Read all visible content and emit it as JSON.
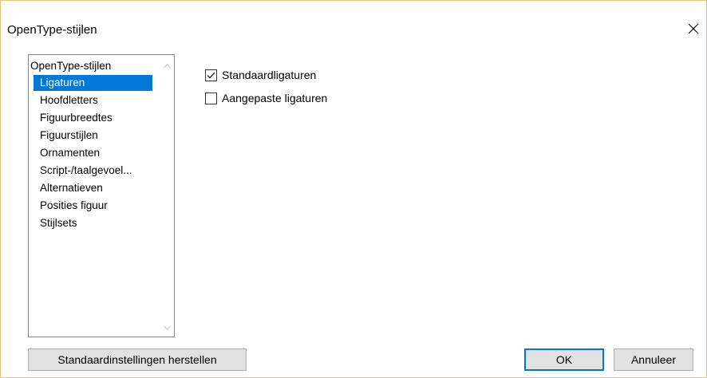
{
  "window": {
    "title": "OpenType-stijlen"
  },
  "features_list": {
    "root": "OpenType-stijlen",
    "items": [
      "Ligaturen",
      "Hoofdletters",
      "Figuurbreedtes",
      "Figuurstijlen",
      "Ornamenten",
      "Script-/taalgevoel...",
      "Alternatieven",
      "Posities figuur",
      "Stijlsets"
    ],
    "selected": "Ligaturen"
  },
  "options": [
    {
      "label": "Standaardligaturen",
      "checked": true
    },
    {
      "label": "Aangepaste ligaturen",
      "checked": false
    }
  ],
  "buttons": {
    "restore_defaults": "Standaardinstellingen herstellen",
    "ok": "OK",
    "cancel": "Annuleer"
  },
  "colors": {
    "selection": "#0078d7",
    "window_border": "#e7c07a"
  }
}
